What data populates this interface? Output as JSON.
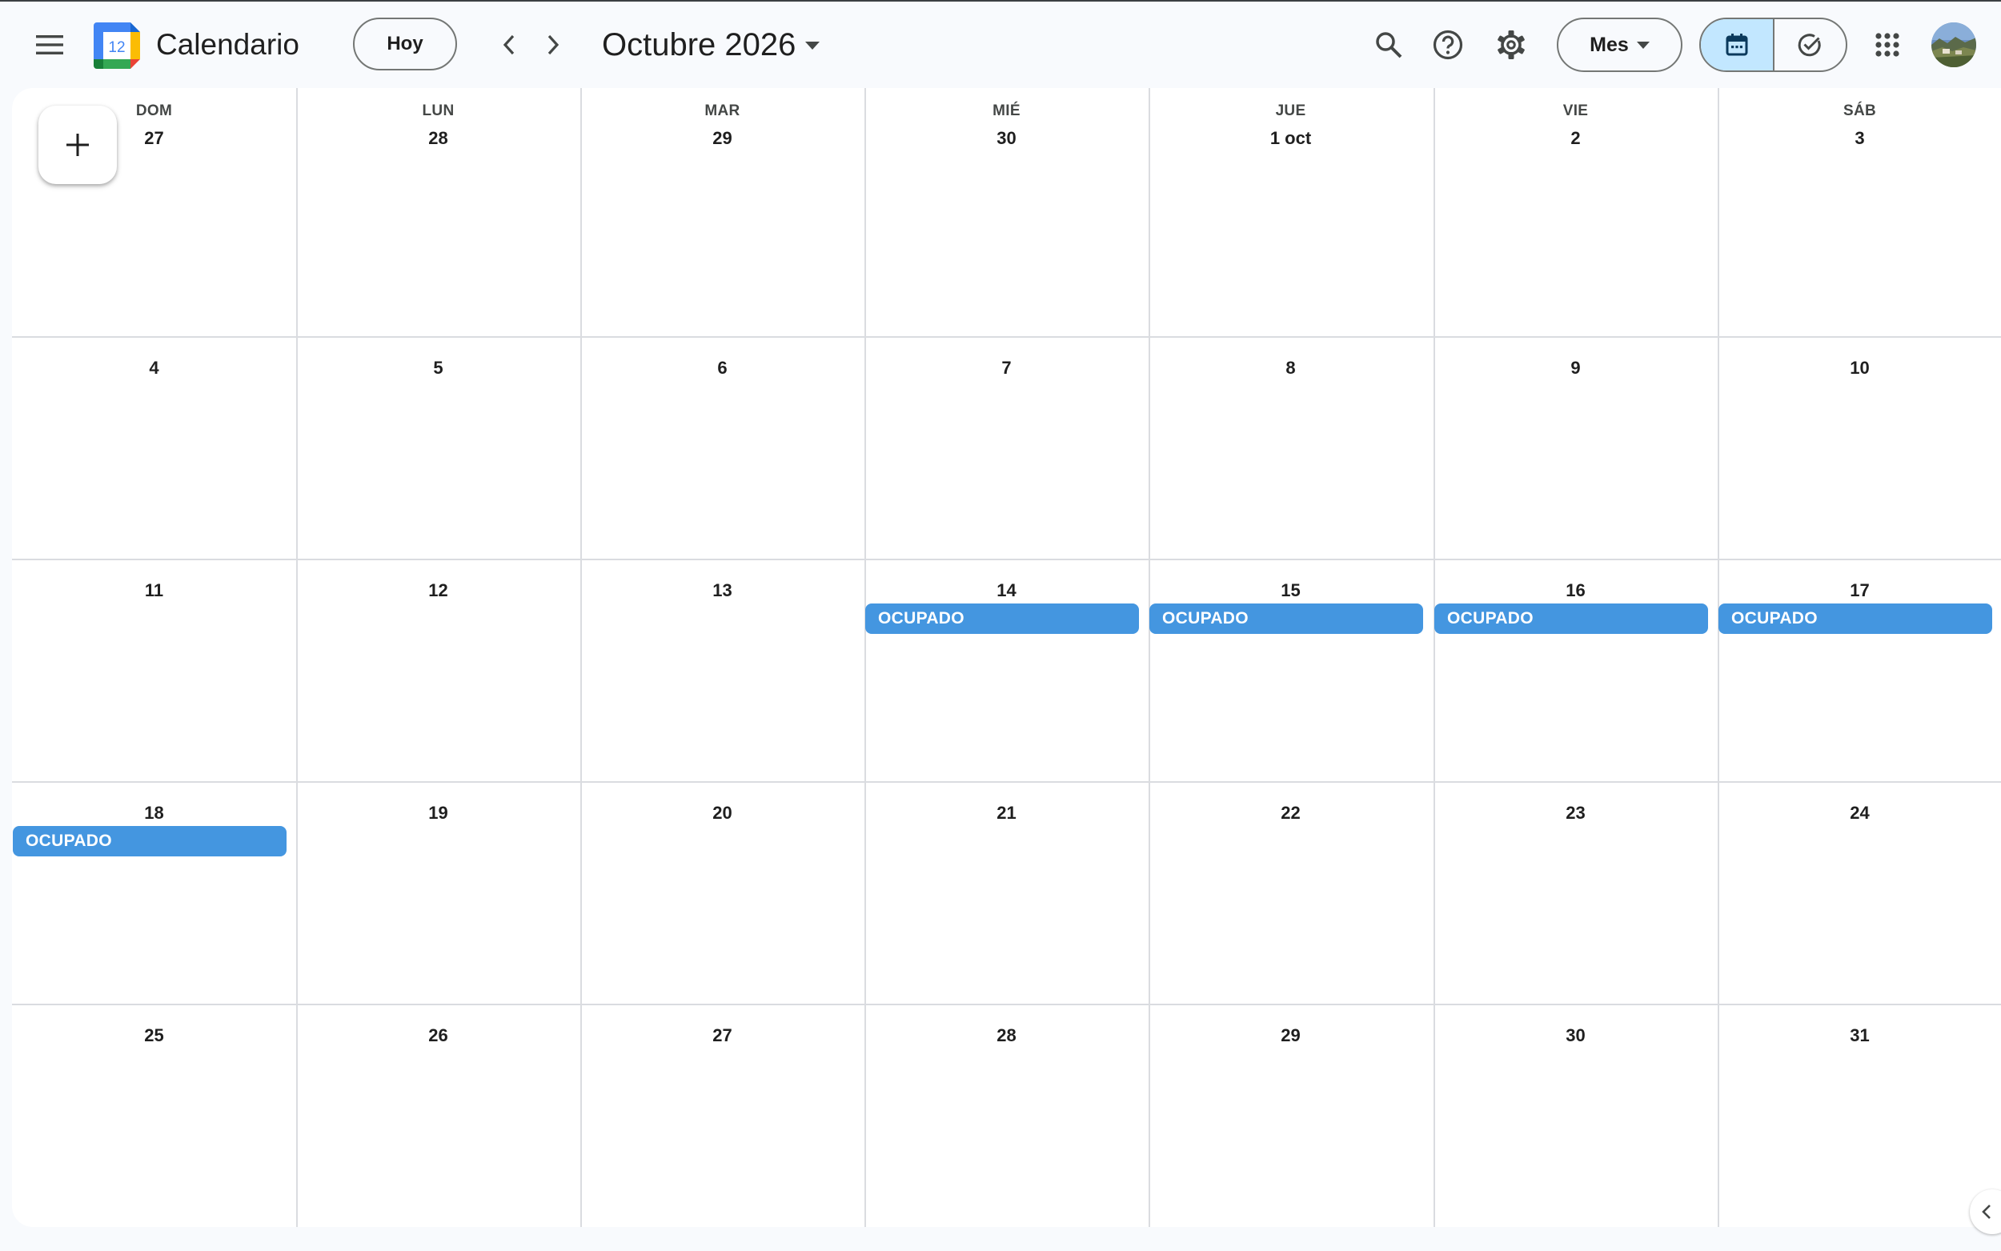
{
  "header": {
    "app_title": "Calendario",
    "logo_number": "12",
    "today_label": "Hoy",
    "month_title": "Octubre 2026",
    "view_label": "Mes",
    "menu_icon": "hamburger-menu-icon",
    "icons": [
      "search-icon",
      "help-icon",
      "gear-icon",
      "apps-grid-icon",
      "calendar-icon",
      "task-check-icon"
    ]
  },
  "colors": {
    "event": "#4496e0",
    "active_segment": "#c2e7ff",
    "background": "#f8fafd"
  },
  "calendar": {
    "weekdays": [
      "DOM",
      "LUN",
      "MAR",
      "MIÉ",
      "JUE",
      "VIE",
      "SÁB"
    ],
    "weeks": [
      [
        "27",
        "28",
        "29",
        "30",
        "1 oct",
        "2",
        "3"
      ],
      [
        "4",
        "5",
        "6",
        "7",
        "8",
        "9",
        "10"
      ],
      [
        "11",
        "12",
        "13",
        "14",
        "15",
        "16",
        "17"
      ],
      [
        "18",
        "19",
        "20",
        "21",
        "22",
        "23",
        "24"
      ],
      [
        "25",
        "26",
        "27",
        "28",
        "29",
        "30",
        "31"
      ]
    ],
    "events": [
      {
        "week": 2,
        "day": 3,
        "label": "OCUPADO"
      },
      {
        "week": 2,
        "day": 4,
        "label": "OCUPADO"
      },
      {
        "week": 2,
        "day": 5,
        "label": "OCUPADO"
      },
      {
        "week": 2,
        "day": 6,
        "label": "OCUPADO"
      },
      {
        "week": 3,
        "day": 0,
        "label": "OCUPADO"
      }
    ]
  }
}
